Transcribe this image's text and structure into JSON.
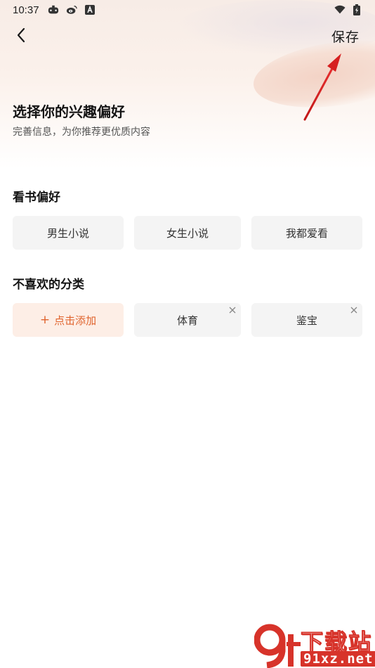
{
  "status_bar": {
    "time": "10:37",
    "left_icons": [
      "game-controller-icon",
      "weibo-icon",
      "font-a-icon"
    ],
    "right_icons": [
      "wifi-icon",
      "battery-icon"
    ]
  },
  "topbar": {
    "back_icon": "chevron-left-icon",
    "save_label": "保存"
  },
  "header": {
    "title": "选择你的兴趣偏好",
    "subtitle": "完善信息，为你推荐更优质内容"
  },
  "reading_pref": {
    "title": "看书偏好",
    "options": [
      {
        "label": "男生小说"
      },
      {
        "label": "女生小说"
      },
      {
        "label": "我都爱看"
      }
    ]
  },
  "disliked": {
    "title": "不喜欢的分类",
    "add_label": "点击添加",
    "add_icon": "plus",
    "items": [
      {
        "label": "体育"
      },
      {
        "label": "鉴宝"
      }
    ]
  },
  "watermark": {
    "logo_text": "9f",
    "text": "下载站",
    "url": "91xz.net"
  },
  "colors": {
    "accent": "#e0642e",
    "chip_bg": "#f4f4f4",
    "add_chip_bg": "#fdeee6",
    "annotation_arrow": "#d62020",
    "watermark_red": "#d7332a"
  }
}
